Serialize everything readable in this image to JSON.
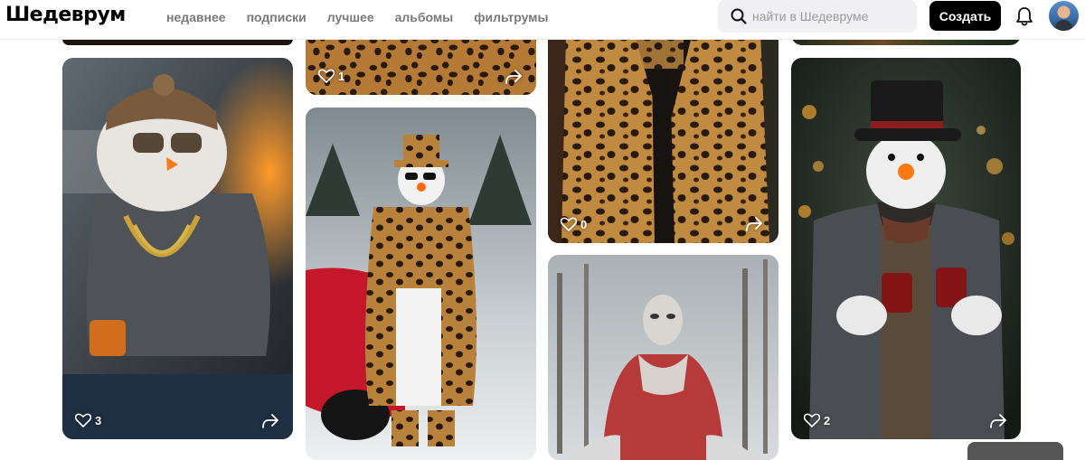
{
  "header": {
    "logo": "Шедеврум",
    "nav": [
      "недавнее",
      "подписки",
      "лучшее",
      "альбомы",
      "фильтрумы"
    ],
    "search_placeholder": "найти в Шедевруме",
    "create_label": "Создать"
  },
  "feed": {
    "cards": [
      {
        "id": "top-left-partial",
        "likes": ""
      },
      {
        "id": "leopard-coat-top",
        "likes": "1"
      },
      {
        "id": "leopard-coat-large",
        "likes": "0"
      },
      {
        "id": "top-right-partial",
        "likes": ""
      },
      {
        "id": "tattoo-snowman",
        "likes": "3"
      },
      {
        "id": "leopard-snowman-car",
        "likes": ""
      },
      {
        "id": "red-jacket-figure",
        "likes": ""
      },
      {
        "id": "tophat-snowman-mugs",
        "likes": "2"
      }
    ]
  }
}
